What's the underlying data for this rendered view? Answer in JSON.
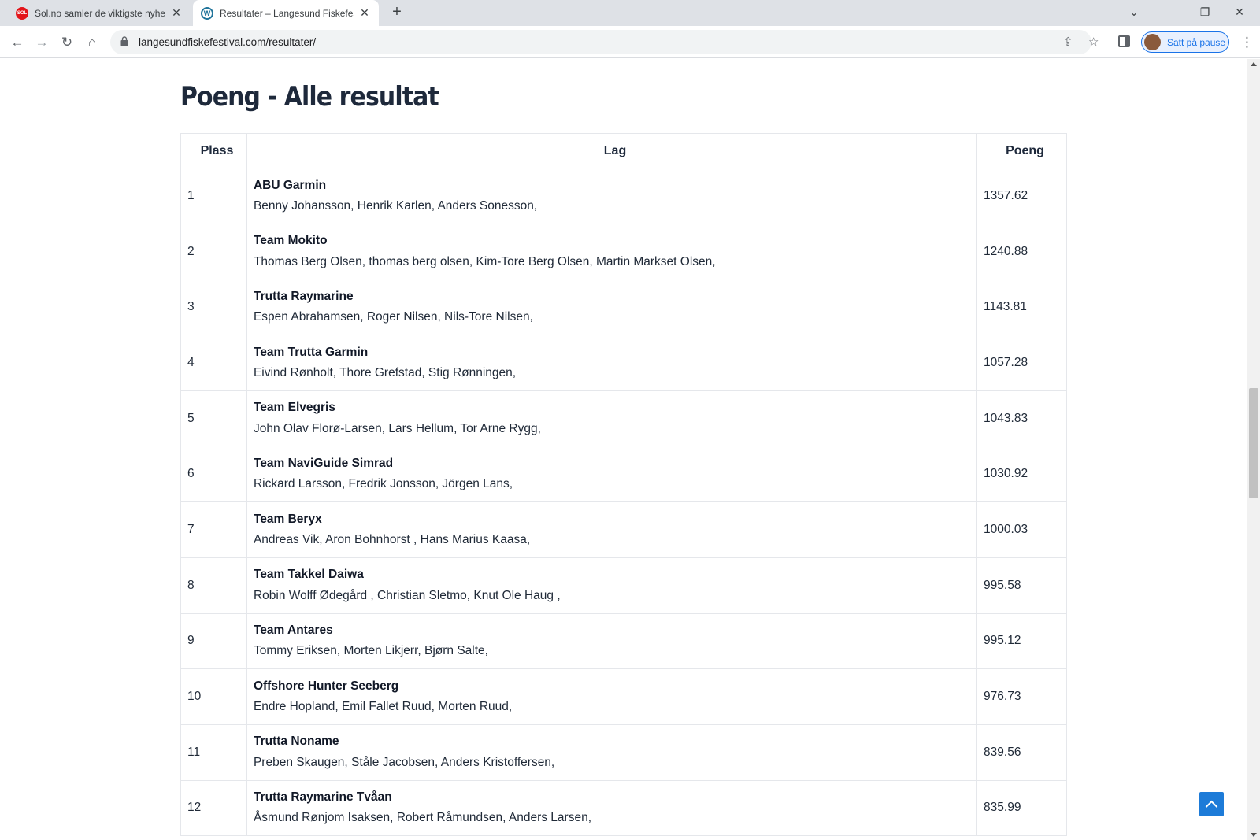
{
  "browser": {
    "tabs": [
      {
        "title": "Sol.no samler de viktigste nyhetene",
        "favicon_text": "SOL",
        "active": false
      },
      {
        "title": "Resultater – Langesund Fiskefestival",
        "favicon_text": "W",
        "active": true
      }
    ],
    "new_tab": "+",
    "url": "langesundfiskefestival.com/resultater/",
    "profile_label": "Satt på pause"
  },
  "page": {
    "title": "Poeng - Alle resultat",
    "table": {
      "headers": [
        "Plass",
        "Lag",
        "Poeng"
      ],
      "rows": [
        {
          "place": "1",
          "team": "ABU Garmin",
          "members": "Benny Johansson, Henrik Karlen, Anders Sonesson,",
          "points": "1357.62"
        },
        {
          "place": "2",
          "team": "Team Mokito",
          "members": "Thomas Berg Olsen, thomas berg olsen, Kim-Tore Berg Olsen, Martin Markset Olsen,",
          "points": "1240.88"
        },
        {
          "place": "3",
          "team": "Trutta Raymarine",
          "members": "Espen Abrahamsen, Roger Nilsen, Nils-Tore Nilsen,",
          "points": "1143.81"
        },
        {
          "place": "4",
          "team": "Team Trutta Garmin",
          "members": "Eivind Rønholt, Thore Grefstad, Stig Rønningen,",
          "points": "1057.28"
        },
        {
          "place": "5",
          "team": "Team Elvegris",
          "members": "John Olav Florø-Larsen, Lars Hellum, Tor Arne Rygg,",
          "points": "1043.83"
        },
        {
          "place": "6",
          "team": "Team NaviGuide Simrad",
          "members": "Rickard Larsson, Fredrik Jonsson, Jörgen Lans,",
          "points": "1030.92"
        },
        {
          "place": "7",
          "team": "Team Beryx",
          "members": "Andreas Vik, Aron Bohnhorst , Hans Marius Kaasa,",
          "points": "1000.03"
        },
        {
          "place": "8",
          "team": "Team Takkel Daiwa",
          "members": "Robin Wolff Ødegård , Christian Sletmo, Knut Ole Haug ,",
          "points": "995.58"
        },
        {
          "place": "9",
          "team": "Team Antares",
          "members": "Tommy Eriksen, Morten Likjerr, Bjørn Salte,",
          "points": "995.12"
        },
        {
          "place": "10",
          "team": "Offshore Hunter Seeberg",
          "members": "Endre Hopland, Emil Fallet Ruud, Morten Ruud,",
          "points": "976.73"
        },
        {
          "place": "11",
          "team": "Trutta Noname",
          "members": "Preben Skaugen, Ståle Jacobsen, Anders Kristoffersen,",
          "points": "839.56"
        },
        {
          "place": "12",
          "team": "Trutta Raymarine Tvåan",
          "members": "Åsmund Rønjom Isaksen, Robert Råmundsen, Anders Larsen,",
          "points": "835.99"
        }
      ]
    }
  },
  "icons": [
    "back-icon",
    "forward-icon",
    "reload-icon",
    "home-icon",
    "lock-icon",
    "share-icon",
    "star-icon",
    "side-panel-icon",
    "menu-icon",
    "scroll-to-top-icon"
  ]
}
